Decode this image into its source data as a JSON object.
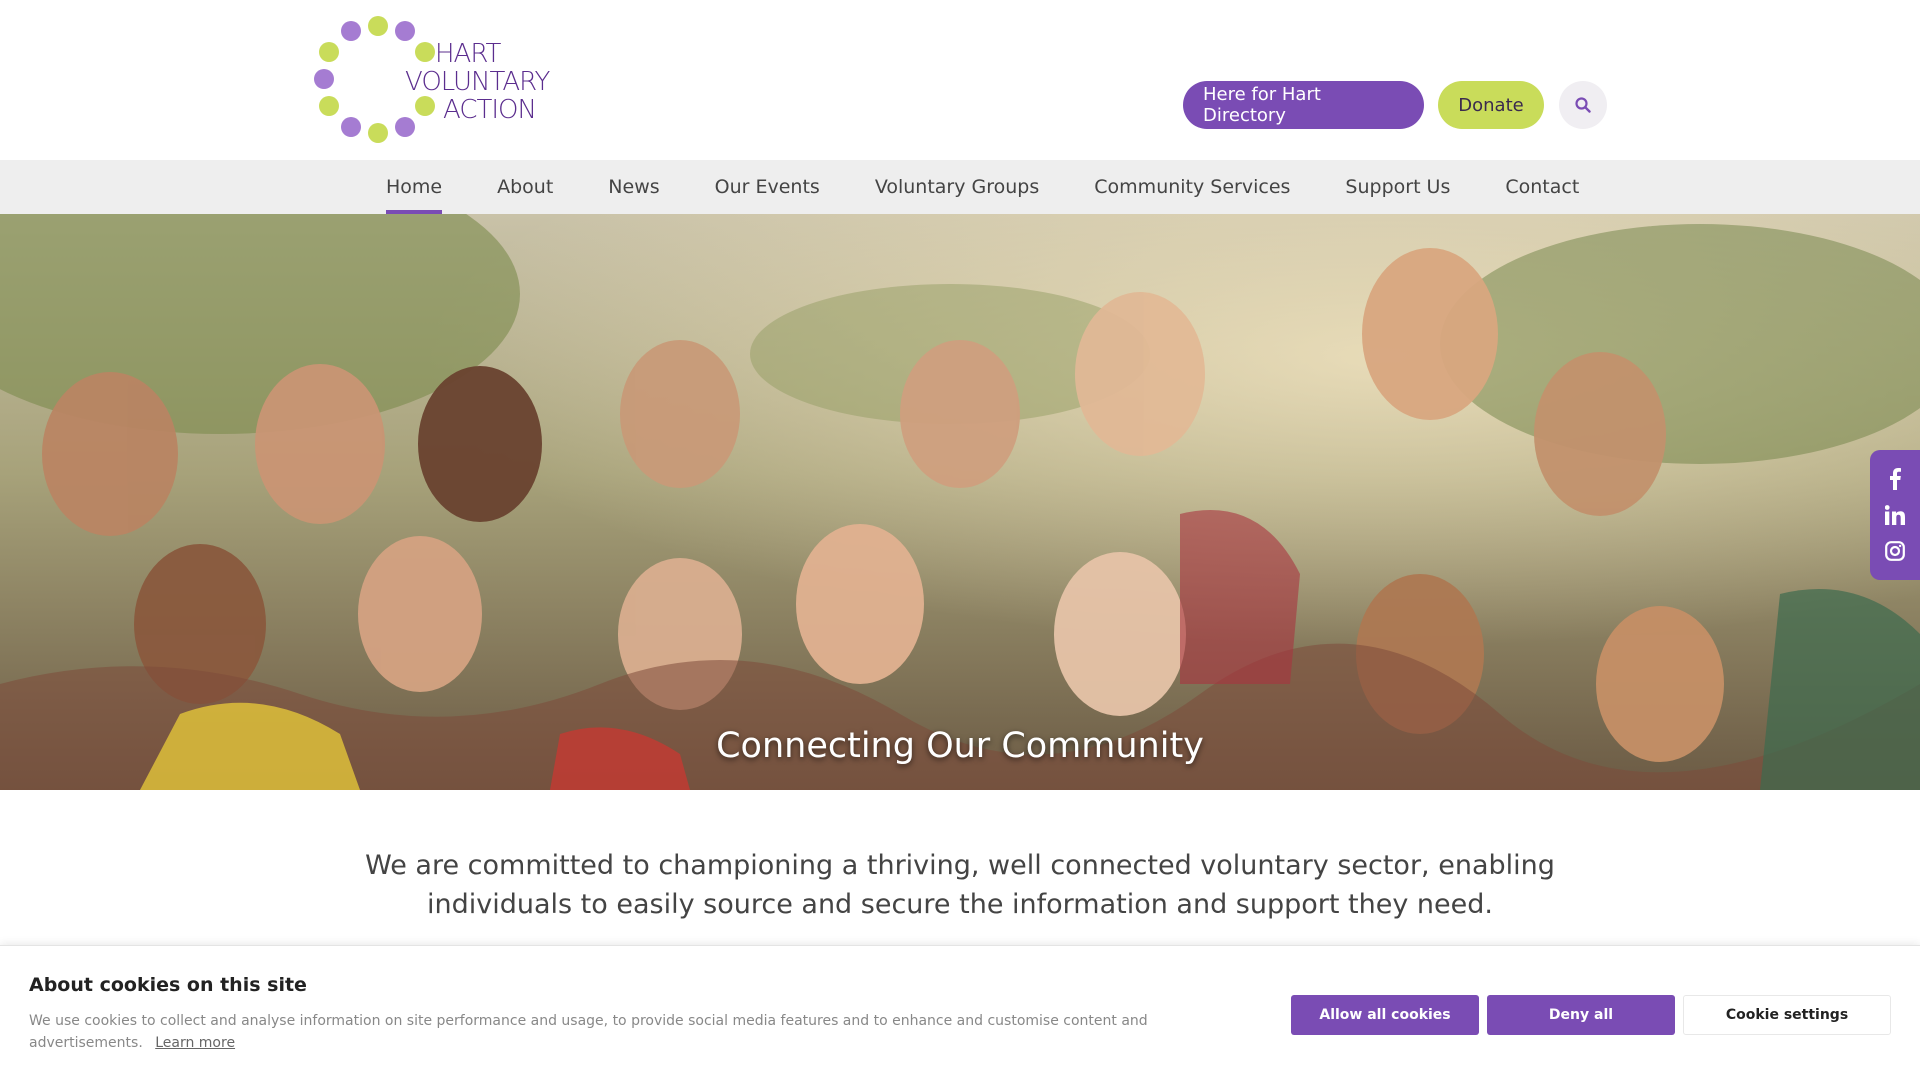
{
  "brand": {
    "logo_lines": [
      "HART",
      "VOLUNTARY",
      "ACTION"
    ],
    "colors": {
      "purple": "#7a4cb4",
      "lime": "#c9dc5a",
      "logo_text": "#5b2d8e"
    }
  },
  "header": {
    "directory_label": "Here for Hart Directory",
    "donate_label": "Donate",
    "search_icon": "search-icon"
  },
  "nav": {
    "items": [
      {
        "label": "Home",
        "active": true
      },
      {
        "label": "About"
      },
      {
        "label": "News"
      },
      {
        "label": "Our Events"
      },
      {
        "label": "Voluntary Groups"
      },
      {
        "label": "Community Services"
      },
      {
        "label": "Support Us"
      },
      {
        "label": "Contact"
      }
    ]
  },
  "hero": {
    "title": "Connecting Our Community"
  },
  "social": {
    "icons": [
      "facebook-icon",
      "linkedin-icon",
      "instagram-icon"
    ]
  },
  "mission": {
    "text": "We are committed to championing a thriving, well connected voluntary sector, enabling individuals to easily source and secure the information and support they need."
  },
  "cookie": {
    "title": "About cookies on this site",
    "description": "We use cookies to collect and analyse information on site performance and usage, to provide social media features and to enhance and customise content and advertisements.",
    "learn_more": "Learn more",
    "allow_label": "Allow all cookies",
    "deny_label": "Deny all",
    "settings_label": "Cookie settings"
  }
}
